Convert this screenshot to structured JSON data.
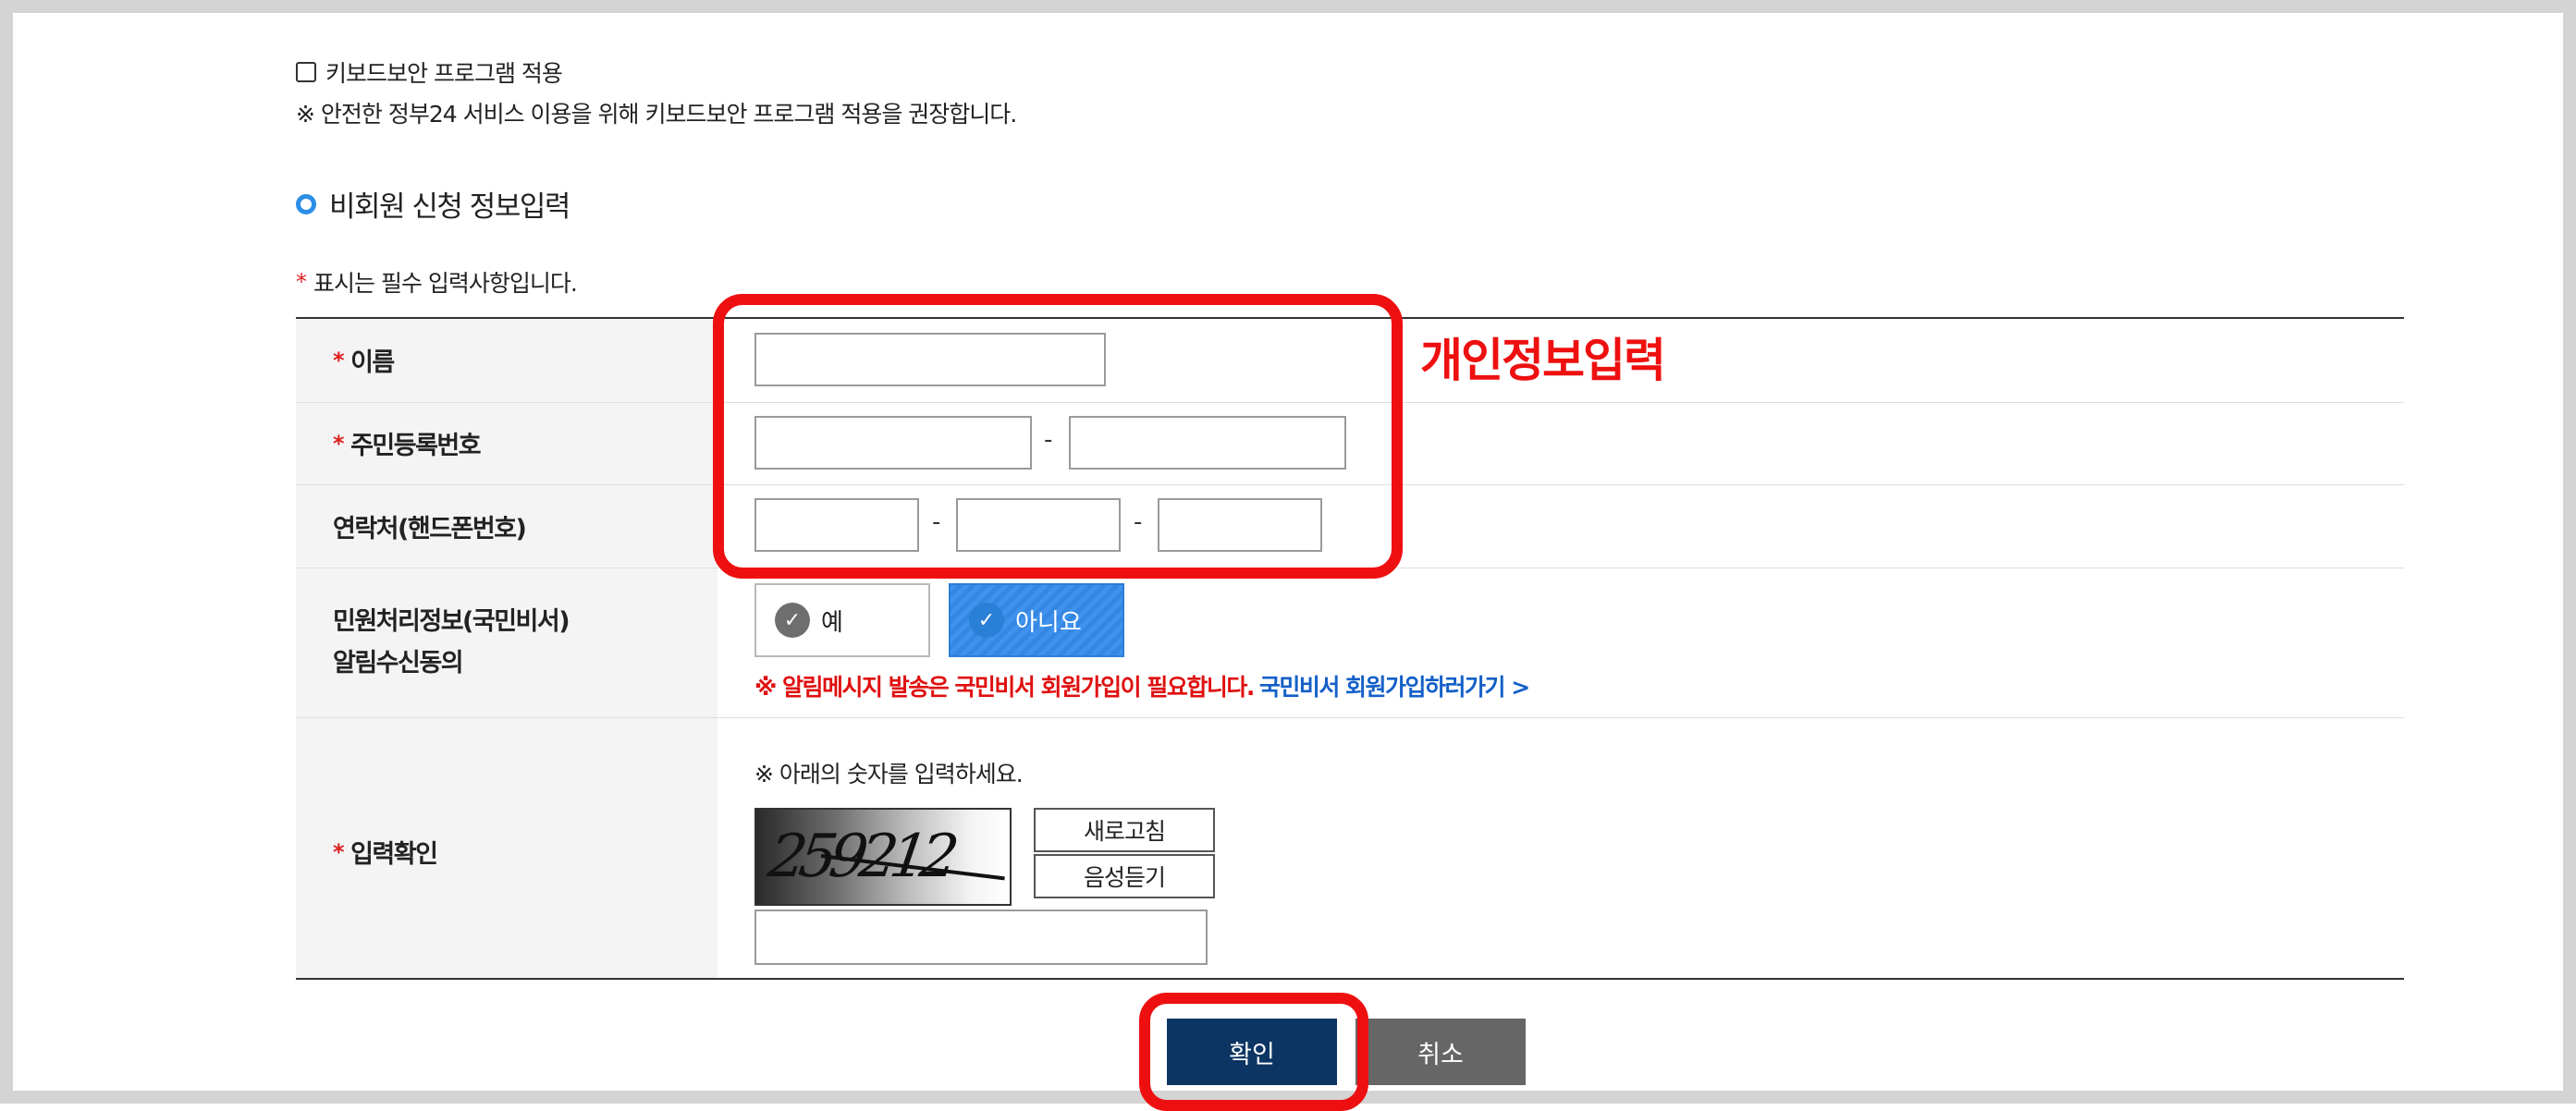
{
  "security": {
    "keyboard_checkbox_label": "키보드보안 프로그램 적용",
    "keyboard_checked": false,
    "notice": "※ 안전한 정부24 서비스 이용을 위해 키보드보안 프로그램 적용을 권장합니다."
  },
  "section": {
    "title": "비회원 신청 정보입력",
    "required_mark": "*",
    "required_note": "표시는 필수 입력사항입니다."
  },
  "form": {
    "name_label": "이름",
    "rrn_label": "주민등록번호",
    "phone_label": "연락처(핸드폰번호)",
    "dash": "-",
    "consent_label_line1": "민원처리정보(국민비서)",
    "consent_label_line2": "알림수신동의",
    "consent_yes": "예",
    "consent_no": "아니요",
    "consent_selected": "아니요",
    "consent_alert": "※  알림메시지 발송은 국민비서 회원가입이 필요합니다.",
    "consent_link": "국민비서 회원가입하러가기 >",
    "captcha_label": "입력확인",
    "captcha_note": "※ 아래의 숫자를 입력하세요.",
    "captcha_digits": "259212",
    "captcha_refresh": "새로고침",
    "captcha_audio": "음성듣기",
    "name_value": "",
    "rrn_front_value": "",
    "rrn_back_value": "",
    "phone_1_value": "",
    "phone_2_value": "",
    "phone_3_value": "",
    "captcha_value": ""
  },
  "actions": {
    "confirm": "확인",
    "cancel": "취소"
  },
  "annotation": {
    "label": "개인정보입력",
    "color": "#ee1010"
  },
  "colors": {
    "primary_button": "#0c3563",
    "cancel_button": "#666666",
    "selected_option": "#3f93ee",
    "alert_text": "#e01010",
    "link_text": "#1460c8"
  }
}
